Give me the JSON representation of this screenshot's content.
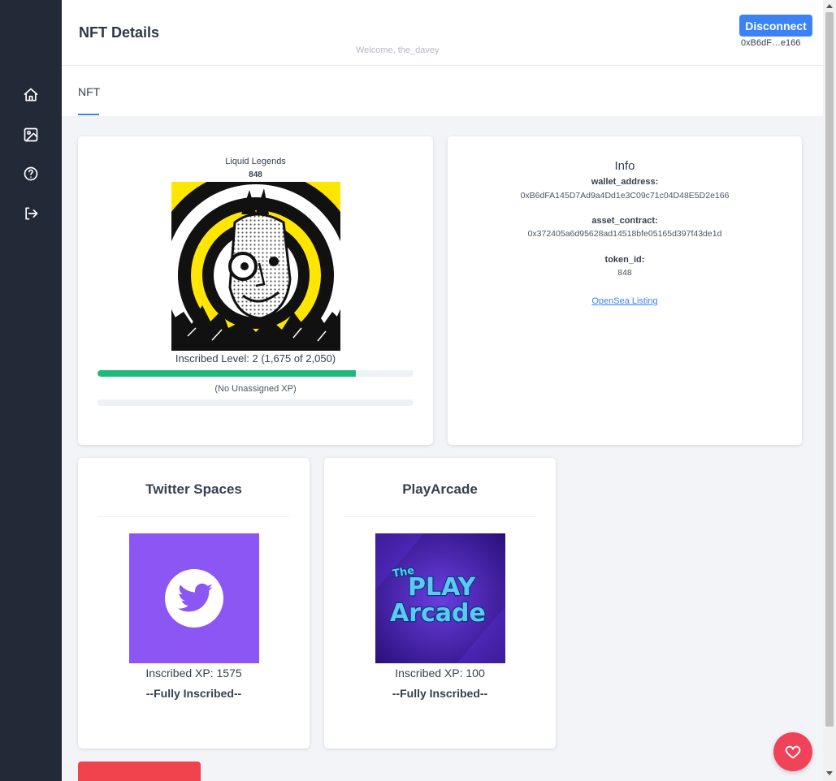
{
  "sidebar": {
    "icons": [
      "home-icon",
      "image-icon",
      "help-icon",
      "logout-icon"
    ]
  },
  "header": {
    "title": "NFT Details",
    "welcome": "Welcome, the_davey",
    "disconnect_label": "Disconnect",
    "wallet_short": "0xB6dF…e166"
  },
  "tabs": [
    {
      "label": "NFT",
      "active": true
    }
  ],
  "nft": {
    "collection": "Liquid Legends",
    "token_id": "848",
    "level_text": "Inscribed Level: 2 (1,675 of 2,050)",
    "level_progress": 0.817,
    "unassigned_text": "(No Unassigned XP)",
    "unassigned_progress": 0
  },
  "info": {
    "title": "Info",
    "fields": [
      {
        "label": "wallet_address:",
        "value": "0xB6dFA145D7Ad9a4Dd1e3C09c71c04D48E5D2e166"
      },
      {
        "label": "asset_contract:",
        "value": "0x372405a6d95628ad14518bfe05165d397f43de1d"
      },
      {
        "label": "token_id:",
        "value": "848"
      }
    ],
    "link_label": "OpenSea Listing"
  },
  "activities": [
    {
      "title": "Twitter Spaces",
      "xp": "Inscribed XP: 1575",
      "status": "--Fully Inscribed--",
      "icon": "twitter-icon",
      "bg": "#8c56f5"
    },
    {
      "title": "PlayArcade",
      "xp": "Inscribed XP: 100",
      "status": "--Fully Inscribed--",
      "icon": "play-arcade-logo",
      "bg": "#3d1aa0"
    }
  ],
  "colors": {
    "sidebar": "#222a38",
    "primary": "#3b82f6",
    "progress": "#1fb97d",
    "danger": "#f0434e"
  }
}
